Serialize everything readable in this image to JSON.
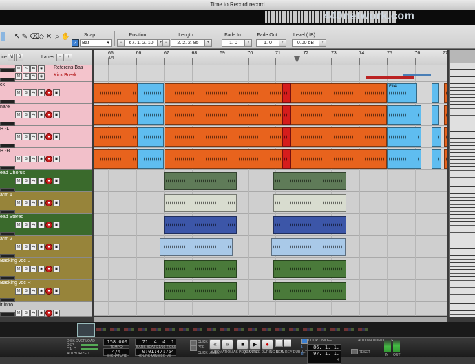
{
  "window": {
    "title": "Time to Record.record"
  },
  "watermark": "440network.com",
  "toolbar": {
    "tools": [
      "arrow-icon",
      "pencil-icon",
      "eraser-icon",
      "razor-icon",
      "mute-icon",
      "magnify-icon",
      "hand-icon"
    ],
    "snap_label": "Snap",
    "snap_value": "Bar",
    "position_label": "Position",
    "position_value": "67. 1. 2. 10",
    "length_label": "Length",
    "length_value": "2. 2. 2. 85",
    "fadein_label": "Fade In",
    "fadein_value": "1. 0",
    "fadeout_label": "Fade Out",
    "fadeout_value": "1. 0",
    "level_label": "Level (dB)",
    "level_value": "0.00 dB"
  },
  "tracklist": {
    "header_left": "ice",
    "header_lanes": "Lanes",
    "tracks": [
      {
        "name": "Referens Bas",
        "color": "#f4c4cc"
      },
      {
        "name": "Kick Break",
        "color": "#f4c4cc"
      },
      {
        "name": "ck",
        "color": "#f2c0ca"
      },
      {
        "name": "nare",
        "color": "#f2c0ca"
      },
      {
        "name": "H -L",
        "color": "#f2c0ca"
      },
      {
        "name": "H -R",
        "color": "#f2c0ca"
      },
      {
        "name": "ead Chorus",
        "color": "#3a6a2c"
      },
      {
        "name": "arm 1",
        "color": "#97843a"
      },
      {
        "name": "ead Stereo",
        "color": "#3a6a2c"
      },
      {
        "name": "arm 2",
        "color": "#97843a"
      },
      {
        "name": "Backing voc L",
        "color": "#97843a"
      },
      {
        "name": "Backing voc R",
        "color": "#97843a"
      },
      {
        "name": "it intro",
        "color": "#c9c9c9"
      }
    ]
  },
  "ruler": {
    "bars": [
      "65",
      "66",
      "67",
      "68",
      "69",
      "70",
      "71",
      "72",
      "73",
      "74",
      "75",
      "76",
      "77"
    ],
    "signature": "4/4"
  },
  "clips": {
    "fill_label": "Fill4"
  },
  "transport": {
    "disk_overload": "DISK OVERLOAD",
    "dsp": "DSP",
    "calc": "CALC",
    "authorized": "AUTHORIZED",
    "tempo_value": "158.000",
    "tempo_label": "TEMPO",
    "signature_value": "4/4",
    "signature_label": "SIGNATURE",
    "bars_value": "71. 4. 4. 1",
    "bars_label": "BARS BEATS 1/16 TICKS",
    "time_value": "0:01:47:754",
    "time_label": "HOURS MIN SEC MS",
    "click_label": "CLICK",
    "pre_label": "PRE",
    "click_level_label": "CLICK LEVEL",
    "automation_label": "AUTOMATION AS PERF CTRL",
    "quantize_label": "QUANTIZE DURING REC",
    "new_label": "NEW REV DUB ALT",
    "loop_label": "LOOP ON/OFF",
    "loop_start": "86. 1. 1. 0",
    "loop_end": "97. 1. 1. 0",
    "loop_l": "L",
    "loop_r": "R",
    "automation_override": "AUTOMATION OVERRIDE",
    "reset": "RESET",
    "in_label": "IN",
    "out_label": "OUT"
  }
}
